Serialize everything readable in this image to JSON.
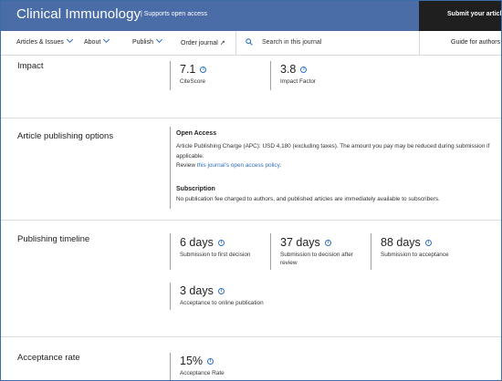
{
  "header": {
    "journal_title": "Clinical Immunology",
    "oa_badge": "Supports open access",
    "submit_label": "Submit your article"
  },
  "nav": {
    "items": [
      "Articles & Issues",
      "About",
      "Publish",
      "Order journal"
    ],
    "search_placeholder": "Search in this journal",
    "guide_label": "Guide for authors"
  },
  "impact": {
    "title": "Impact",
    "metrics": [
      {
        "value": "7.1",
        "label": "CiteScore"
      },
      {
        "value": "3.8",
        "label": "Impact Factor"
      }
    ]
  },
  "publishing_options": {
    "title": "Article publishing options",
    "open_access_heading": "Open Access",
    "open_access_text": "Article Publishing Charge (APC): USD 4,180 (excluding taxes). The amount you pay may be reduced during submission if applicable.",
    "review_prefix": "Review ",
    "review_link": "this journal's open access policy",
    "review_suffix": ".",
    "subscription_heading": "Subscription",
    "subscription_text": "No publication fee charged to authors, and published articles are immediately available to subscribers."
  },
  "timeline": {
    "title": "Publishing timeline",
    "metrics": [
      {
        "value": "6 days",
        "label": "Submission to first decision"
      },
      {
        "value": "37 days",
        "label": "Submission to decision after review"
      },
      {
        "value": "88 days",
        "label": "Submission to acceptance"
      },
      {
        "value": "3 days",
        "label": "Acceptance to online publication"
      }
    ]
  },
  "acceptance": {
    "title": "Acceptance rate",
    "value": "15%",
    "label": "Acceptance Rate"
  },
  "colors": {
    "header_bg": "#4a6da7",
    "submit_bg": "#1f1f1f",
    "accent": "#2f6fbf"
  }
}
